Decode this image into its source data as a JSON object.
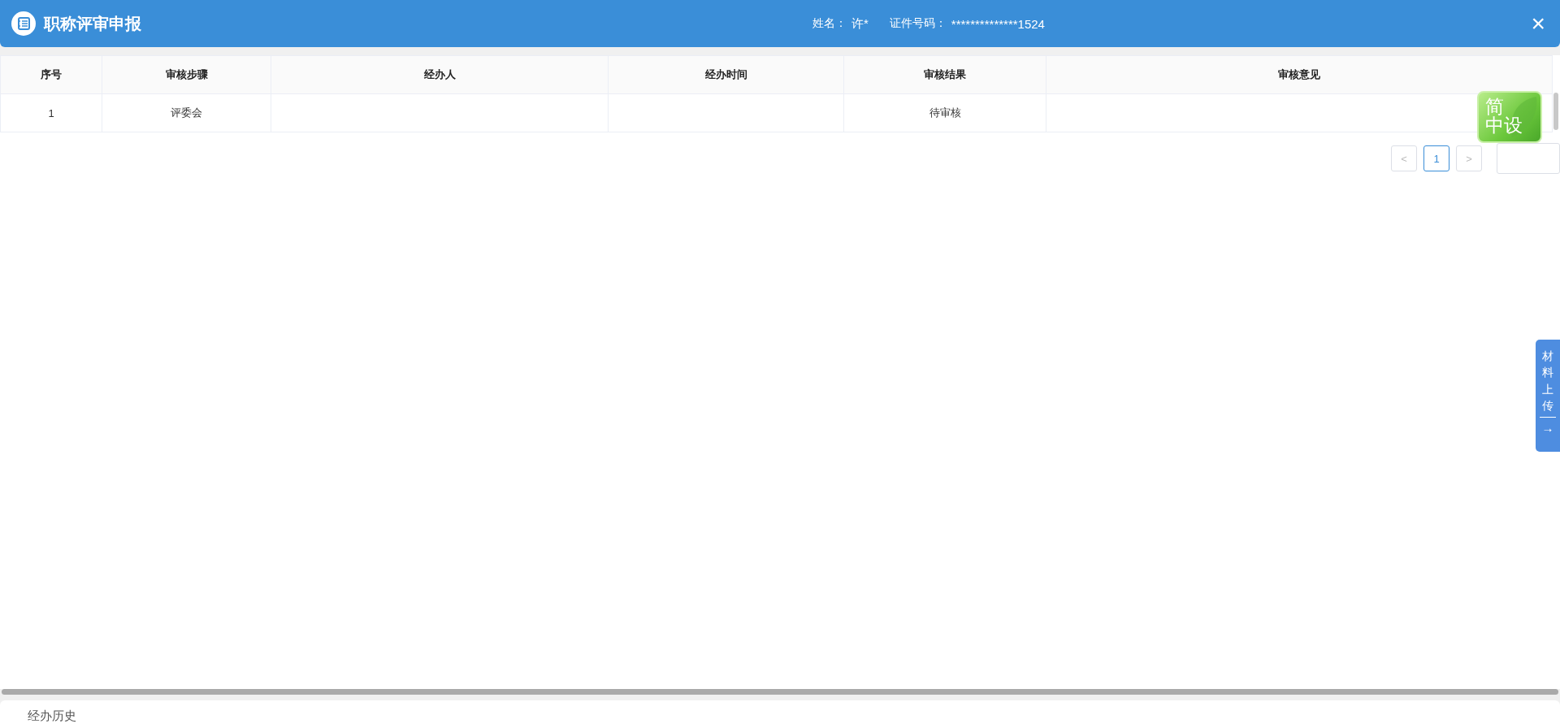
{
  "header": {
    "title": "职称评审申报",
    "name_label": "姓名：",
    "name_value": "许*",
    "id_label": "证件号码：",
    "id_value": "**************1524",
    "close": "×"
  },
  "table": {
    "columns": [
      "序号",
      "审核步骤",
      "经办人",
      "经办时间",
      "审核结果",
      "审核意见"
    ],
    "rows": [
      [
        "1",
        "评委会",
        "",
        "",
        "待审核",
        ""
      ]
    ]
  },
  "pagination": {
    "prev": "<",
    "next": ">",
    "pages": [
      {
        "label": "1",
        "selected": true
      }
    ]
  },
  "badge": {
    "lines": [
      "简",
      "中设"
    ]
  },
  "side_tab": {
    "label": "材料上传",
    "arrow": "→"
  },
  "section": {
    "title": "经办历史"
  }
}
